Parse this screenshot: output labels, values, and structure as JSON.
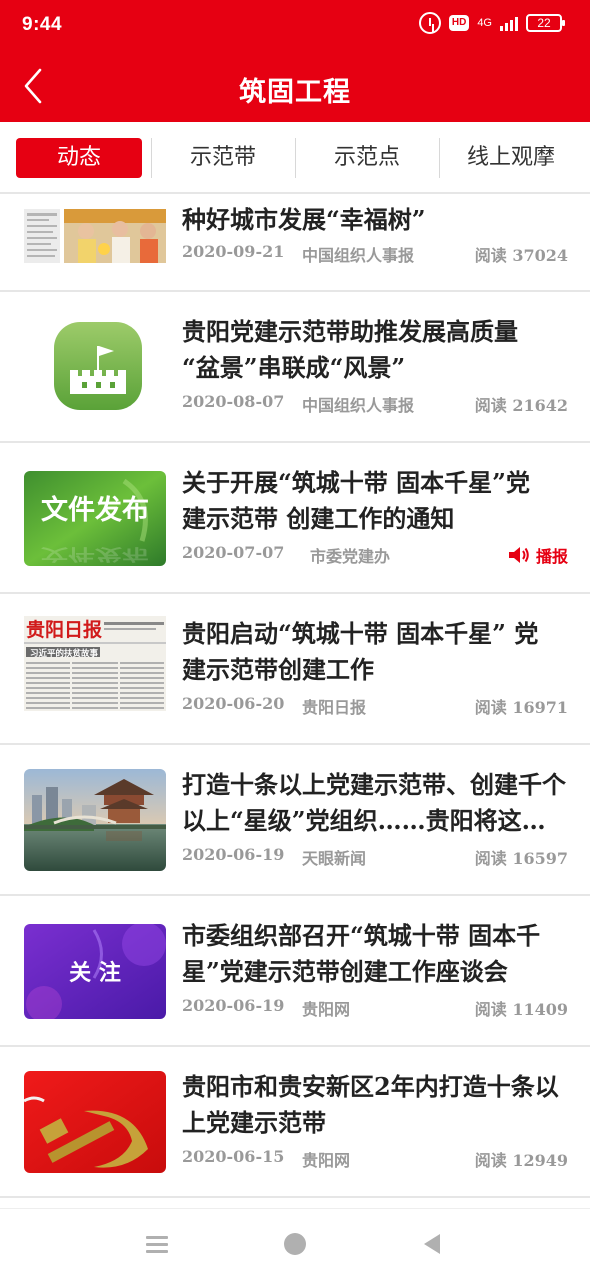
{
  "status_bar": {
    "time": "9:44",
    "network": "4G",
    "battery": "22",
    "hd_badge": "HD"
  },
  "header": {
    "title": "筑固工程",
    "back_icon": "chevron-left-icon"
  },
  "tabs": [
    {
      "label": "动态",
      "active": true
    },
    {
      "label": "示范带",
      "active": false
    },
    {
      "label": "示范点",
      "active": false
    },
    {
      "label": "线上观摩",
      "active": false
    }
  ],
  "articles": [
    {
      "title_lines": [
        "种好城市发展“幸福树”"
      ],
      "date": "2020-09-21",
      "source": "中国组织人事报",
      "reads": "阅读 37024",
      "thumb": "newspaper-and-photo"
    },
    {
      "title_lines": [
        "贵阳党建示范带助推发展高质量",
        "“盆景”串联成“风景”"
      ],
      "date": "2020-08-07",
      "source": "中国组织人事报",
      "reads": "阅读 21642",
      "thumb": "green-castle-flag-icon"
    },
    {
      "title_lines": [
        "关于开展“筑城十带 固本千星”党",
        "建示范带 创建工作的通知"
      ],
      "date": "2020-07-07",
      "source": "市委党建办",
      "broadcast": "播报",
      "thumb": "文件发布"
    },
    {
      "title_lines": [
        "贵阳启动“筑城十带 固本千星” 党",
        "建示范带创建工作"
      ],
      "date": "2020-06-20",
      "source": "贵阳日报",
      "reads": "阅读 16971",
      "thumb": "贵阳日报 newspaper"
    },
    {
      "title_lines": [
        "打造十条以上党建示范带、创建千个",
        "以上“星级”党组织……贵阳将这…"
      ],
      "date": "2020-06-19",
      "source": "天眼新闻",
      "reads": "阅读 16597",
      "thumb": "city-pavilion-photo"
    },
    {
      "title_lines": [
        "市委组织部召开“筑城十带 固本千",
        "星”党建示范带创建工作座谈会"
      ],
      "date": "2020-06-19",
      "source": "贵阳网",
      "reads": "阅读 11409",
      "thumb": "关 注"
    },
    {
      "title_lines": [
        "贵阳市和贵安新区2年内打造十条以",
        "上党建示范带"
      ],
      "date": "2020-06-15",
      "source": "贵阳网",
      "reads": "阅读 12949",
      "thumb": "hammer-sickle-icon"
    }
  ],
  "thumb_texts": {
    "wenjian": "文件发布",
    "guanzhu": "关 注",
    "newspaper_head": "贵阳日报",
    "newspaper_sub": "习近平的扶贫故事"
  },
  "nav": {
    "menu_icon": "menu-icon",
    "home_icon": "home-circle-icon",
    "back_icon": "back-triangle-icon"
  },
  "colors": {
    "brand_red": "#e60012",
    "broadcast_red": "#e60012"
  }
}
